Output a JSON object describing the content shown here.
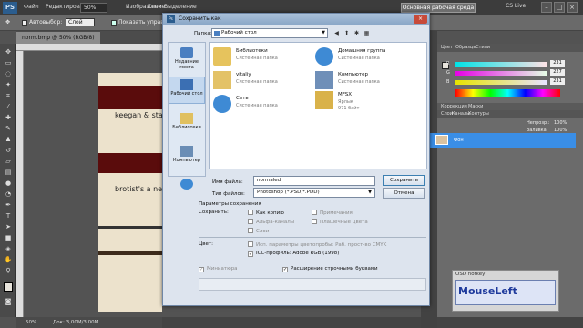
{
  "photoshop": {
    "logo": "PS",
    "menu": [
      "Файл",
      "Редактирование",
      "Изображение",
      "Слои",
      "Выделение"
    ],
    "zoom": "50%",
    "workspace_button": "Основная рабочая среда",
    "cs_live": "CS Live",
    "window_buttons": [
      "–",
      "□",
      "×"
    ],
    "options_bar": {
      "autoselect_label": "Автовыбор:",
      "autoselect_value": "Слой",
      "show_controls_label": "Показать управл."
    },
    "document_tab": "norm.bmp @ 50% (RGB/8)",
    "canvas_text": [
      "keegan & sta",
      "brotist's a ne"
    ],
    "status": {
      "zoom": "50%",
      "doc": "Док: 3,00M/3,00M"
    },
    "color_panel": {
      "tabs": [
        "Цвет",
        "Образцы",
        "Стили"
      ],
      "sliders": [
        {
          "label": "R",
          "value": "231"
        },
        {
          "label": "G",
          "value": "227"
        },
        {
          "label": "B",
          "value": "231"
        }
      ]
    },
    "adjust_panel": {
      "tabs": [
        "Коррекция",
        "Маски"
      ]
    },
    "layers_panel": {
      "tabs": [
        "Слои",
        "Каналы",
        "Контуры"
      ],
      "opacity_label": "Непрозр.:",
      "opacity_value": "100%",
      "fill_label": "Заливка:",
      "fill_value": "100%",
      "layer_name": "Фон"
    }
  },
  "dialog": {
    "title": "Сохранить как",
    "close": "×",
    "folder_label": "Папка:",
    "folder_value": "Рабочий стол",
    "places": [
      {
        "label": "Недавние места",
        "icon": "recent-places-icon"
      },
      {
        "label": "Рабочий стол",
        "icon": "desktop-icon"
      },
      {
        "label": "Библиотеки",
        "icon": "libraries-icon"
      },
      {
        "label": "Компьютер",
        "icon": "computer-icon"
      },
      {
        "label": "",
        "icon": "network-globe-icon"
      }
    ],
    "files": [
      {
        "name": "Библиотеки",
        "type": "Системная папка",
        "extra": "",
        "icon": "libraries-icon"
      },
      {
        "name": "Домашняя группа",
        "type": "Системная папка",
        "extra": "",
        "icon": "homegroup-icon"
      },
      {
        "name": "vitaliy",
        "type": "Системная папка",
        "extra": "",
        "icon": "user-folder-icon"
      },
      {
        "name": "Компьютер",
        "type": "Системная папка",
        "extra": "",
        "icon": "computer-icon"
      },
      {
        "name": "Сеть",
        "type": "Системная папка",
        "extra": "",
        "icon": "network-icon"
      },
      {
        "name": "MFSX",
        "type": "Ярлык",
        "extra": "971 байт",
        "icon": "shortcut-icon"
      }
    ],
    "filename_label": "Имя файла:",
    "filename_value": "normaled",
    "filetype_label": "Тип файлов:",
    "filetype_value": "Photoshop (*.PSD;*.PDD)",
    "save_button": "Сохранить",
    "cancel_button": "Отмена",
    "save_options_title": "Параметры сохранения",
    "save_label": "Сохранить:",
    "options": {
      "as_copy": "Как копию",
      "annotations": "Примечания",
      "alpha": "Альфа-каналы",
      "spot": "Плашечные цвета",
      "layers": "Слои"
    },
    "color_label": "Цвет:",
    "proof_setup": "Исп. параметры цветопробы:  Раб. прост-во CMYK",
    "icc_profile": "ICC-профиль:  Adobe RGB (1998)",
    "thumbnail": "Миниатюра",
    "lowercase_ext": "Расширение строчными буквами"
  },
  "osd": {
    "title": "OSD hotkey",
    "text": "MouseLeft"
  }
}
